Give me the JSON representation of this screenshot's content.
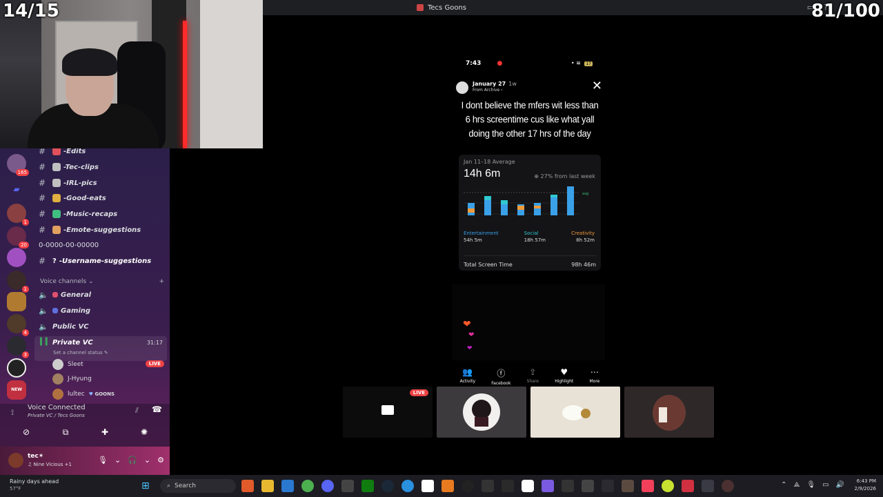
{
  "window": {
    "title": "Tecs Goons"
  },
  "counters": {
    "left": "14/15",
    "right": "81/100"
  },
  "discord": {
    "servers": [
      {
        "color": "#7a5a8a",
        "badge": "165"
      },
      {
        "color": "#5865f2",
        "badge": ""
      },
      {
        "color": "#8a4040",
        "badge": "1"
      },
      {
        "color": "#6a2a4a",
        "badge": "20"
      },
      {
        "color": "#a050c0",
        "badge": ""
      },
      {
        "color": "#3a2a2a",
        "badge": "1"
      },
      {
        "color": "#b07a30",
        "badge": ""
      },
      {
        "color": "#503a2a",
        "badge": "4"
      },
      {
        "color": "#2a2a30",
        "badge": "3"
      },
      {
        "color": "#222222",
        "badge": ""
      },
      {
        "color": "#c03040",
        "badge": "NEW"
      }
    ],
    "channels": [
      {
        "name": "-Edits",
        "emoji_color": "#e0505a"
      },
      {
        "name": "-Tec-clips",
        "emoji_color": "#c0c0c0"
      },
      {
        "name": "-IRL-pics",
        "emoji_color": "#c0c0c0"
      },
      {
        "name": "-Good-eats",
        "emoji_color": "#e0b040"
      },
      {
        "name": "-Music-recaps",
        "emoji_color": "#40c080"
      },
      {
        "name": "-Emote-suggestions",
        "emoji_color": "#e0a060"
      },
      {
        "name": "0-0000-00-00000",
        "emoji_color": ""
      },
      {
        "name": "-Username-suggestions",
        "emoji_color": ""
      }
    ],
    "voice_header": "Voice channels",
    "voice_channels": [
      {
        "name": "General",
        "emoji_color": "#e05070"
      },
      {
        "name": "Gaming",
        "emoji_color": "#6070e0"
      },
      {
        "name": "Public VC",
        "emoji_color": ""
      }
    ],
    "private_vc": {
      "name": "Private VC",
      "time": "31:17",
      "status": "Set a channel status"
    },
    "members": [
      {
        "name": "Sleet",
        "badge": "LIVE",
        "color": "#ccc"
      },
      {
        "name": "J-Hyung",
        "badge": "",
        "color": "#a08060"
      },
      {
        "name": "lultec",
        "badge": "GOONS",
        "color": "#b07040"
      }
    ],
    "voice_panel": {
      "title": "Voice Connected",
      "subtitle": "Private VC / Tecs Goons"
    },
    "user": {
      "name": "tec",
      "status": "Nine Vicious +1"
    }
  },
  "phone": {
    "time": "7:43",
    "battery": "17",
    "story": {
      "date": "January 27",
      "ago": "1w",
      "archive": "From Archive",
      "text": "I dont believe the mfers wit less than 6 hrs screentime cus like what yall doing the other 17 hrs of the day"
    },
    "screentime": {
      "range": "Jan 11–18 Average",
      "average": "14h 6m",
      "change": "27% from last week",
      "categories": [
        {
          "name": "Entertainment",
          "value": "54h 5m",
          "color": "#3aa0e8"
        },
        {
          "name": "Social",
          "value": "18h 57m",
          "color": "#30c8d0"
        },
        {
          "name": "Creativity",
          "value": "8h 52m",
          "color": "#f09a3a"
        }
      ],
      "total_label": "Total Screen Time",
      "total_value": "98h 46m"
    },
    "actions": [
      {
        "label": "Activity",
        "icon": "👥",
        "dim": false
      },
      {
        "label": "Facebook",
        "icon": "ⓕ",
        "dim": false
      },
      {
        "label": "Share",
        "icon": "⇪",
        "dim": true
      },
      {
        "label": "Highlight",
        "icon": "♥",
        "dim": false
      },
      {
        "label": "More",
        "icon": "⋯",
        "dim": false
      }
    ]
  },
  "tiles": [
    {
      "live": "LIVE",
      "bg": "#0c0c0c"
    },
    {
      "live": "",
      "bg": "#3d3a3d"
    },
    {
      "live": "",
      "bg": "#e8e2d6"
    },
    {
      "live": "",
      "bg": "#2e2828"
    }
  ],
  "taskbar": {
    "weather_title": "Rainy days ahead",
    "weather_temp": "57°F",
    "search": "Search",
    "time": "6:43 PM",
    "date": "2/9/2026"
  }
}
